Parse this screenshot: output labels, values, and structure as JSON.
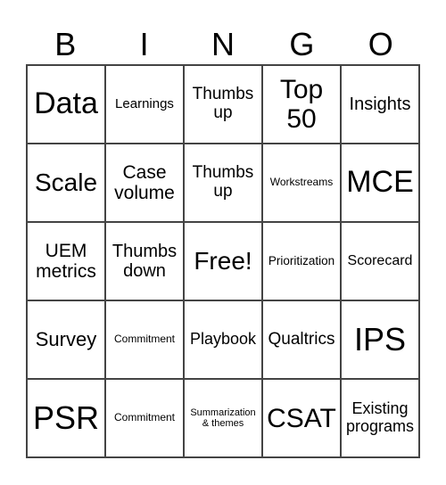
{
  "header": [
    "B",
    "I",
    "N",
    "G",
    "O"
  ],
  "cells": [
    "Data",
    "Learnings",
    "Thumbs up",
    "Top 50",
    "Insights",
    "Scale",
    "Case volume",
    "Thumbs up",
    "Workstreams",
    "MCE",
    "UEM metrics",
    "Thumbs down",
    "Free!",
    "Prioritization",
    "Scorecard",
    "Survey",
    "Commitment",
    "Playbook",
    "Qualtrics",
    "IPS",
    "PSR",
    "Commitment",
    "Summarization & themes",
    "CSAT",
    "Existing programs"
  ]
}
